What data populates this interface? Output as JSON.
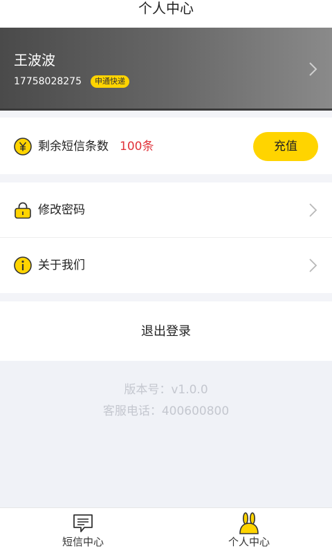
{
  "header": {
    "title": "个人中心"
  },
  "profile": {
    "name": "王波波",
    "phone": "17758028275",
    "badge": "申通快递"
  },
  "sms": {
    "label": "剩余短信条数",
    "count": "100条",
    "recharge_label": "充值"
  },
  "menu": {
    "items": [
      {
        "label": "修改密码",
        "icon": "lock-icon"
      },
      {
        "label": "关于我们",
        "icon": "info-icon"
      }
    ]
  },
  "logout": {
    "label": "退出登录"
  },
  "footer": {
    "version": "版本号：v1.0.0",
    "service": "客服电话：400600800"
  },
  "tabbar": {
    "tabs": [
      {
        "label": "短信中心",
        "icon": "message-icon"
      },
      {
        "label": "个人中心",
        "icon": "rabbit-icon"
      }
    ]
  },
  "colors": {
    "accent": "#ffd400",
    "count": "#e0323a",
    "muted": "#c4c7cf"
  }
}
